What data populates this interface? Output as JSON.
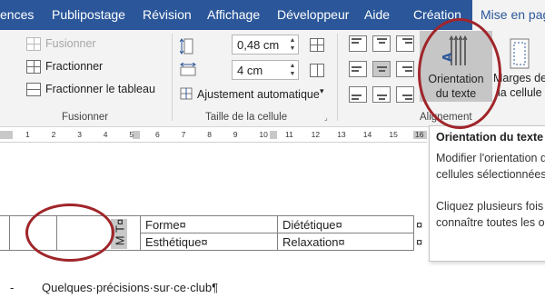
{
  "tabs": [
    {
      "label": "ences"
    },
    {
      "label": "Publipostage"
    },
    {
      "label": "Révision"
    },
    {
      "label": "Affichage"
    },
    {
      "label": "Développeur"
    },
    {
      "label": "Aide"
    },
    {
      "label": "Création"
    },
    {
      "label": "Mise en page"
    }
  ],
  "ribbon": {
    "merge": {
      "fusionner": "Fusionner",
      "fractionner": "Fractionner",
      "fractionner_tableau": "Fractionner le tableau",
      "group_label": "Fusionner"
    },
    "cell_size": {
      "height": "0,48 cm",
      "width": "4 cm",
      "autofit": "Ajustement automatique",
      "group_label": "Taille de la cellule"
    },
    "alignment": {
      "orientation_line1": "Orientation",
      "orientation_line2": "du texte",
      "margins_line1": "Marges de",
      "margins_line2": "la cellule",
      "group_label": "Alignement"
    }
  },
  "ruler": {
    "numbers": [
      "1",
      "2",
      "3",
      "4",
      "5",
      "6",
      "7",
      "8",
      "9",
      "10",
      "11",
      "12",
      "13",
      "14",
      "15",
      "16"
    ]
  },
  "tooltip": {
    "title": "Orientation du texte",
    "line1": "Modifier l'orientation d",
    "line2": "cellules sélectionnées.",
    "line3": "Cliquez plusieurs fois su",
    "line4": "connaître toutes les orie"
  },
  "document": {
    "rotated_cell_text": "M T¤",
    "rows": [
      {
        "c1": "Forme¤",
        "c2": "Diététique¤",
        "end": "¤"
      },
      {
        "c1": "Esthétique¤",
        "c2": "Relaxation¤",
        "end": "¤"
      }
    ],
    "heading_bullet": "-",
    "heading": "Quelques·précisions·sur·ce·club¶"
  },
  "colors": {
    "ribbon_tab_bar": "#2b579a",
    "highlight_ellipse": "#a0252a",
    "selected_button": "#c6c6c6"
  }
}
